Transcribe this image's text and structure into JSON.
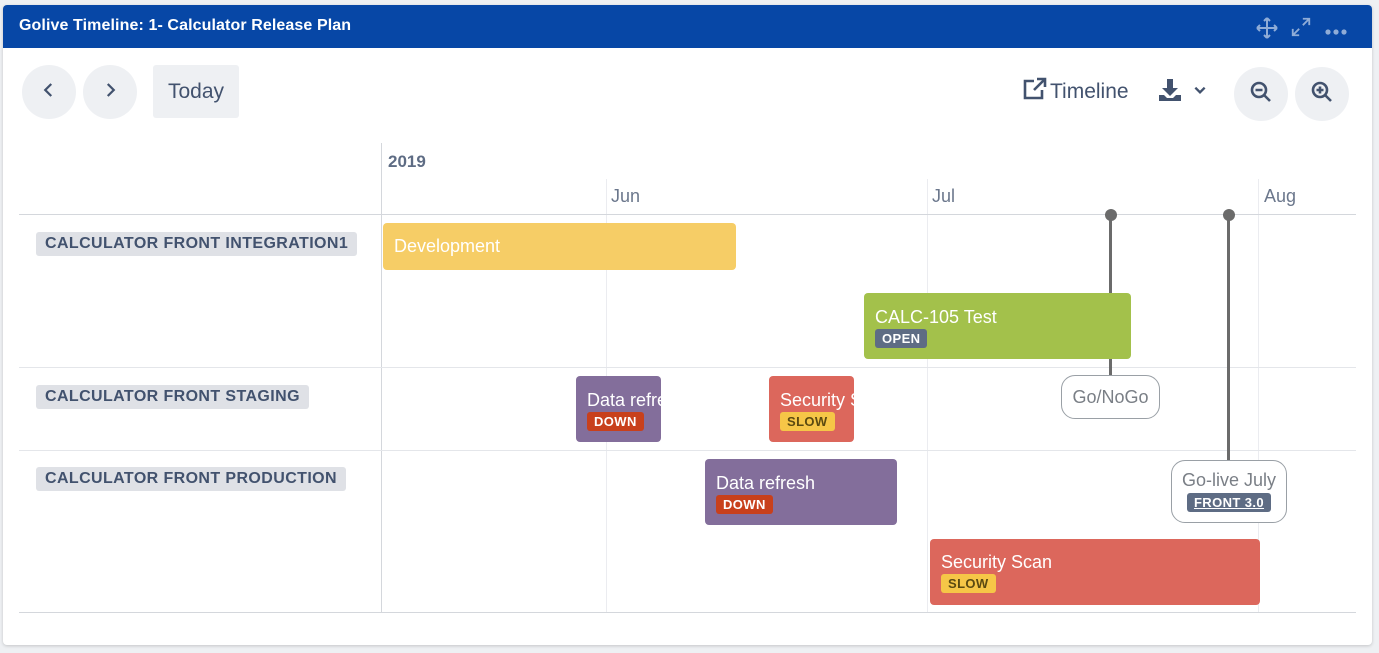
{
  "header": {
    "title": "Golive Timeline: 1- Calculator Release Plan"
  },
  "titlebar_icons": [
    "move-icon",
    "expand-icon",
    "more-icon"
  ],
  "toolbar": {
    "today_label": "Today",
    "timeline_label": "Timeline"
  },
  "timeline": {
    "year": "2019",
    "months": [
      "Jun",
      "Jul",
      "Aug"
    ]
  },
  "lanes": [
    {
      "label": "CALCULATOR FRONT INTEGRATION1"
    },
    {
      "label": "CALCULATOR FRONT STAGING"
    },
    {
      "label": "CALCULATOR FRONT PRODUCTION"
    }
  ],
  "bars": [
    {
      "text": "Development",
      "status": "",
      "color": "#f6cd66"
    },
    {
      "text": "CALC-105 Test",
      "status": "OPEN",
      "color": "#a3c14b"
    },
    {
      "text": "Data refresh",
      "status": "DOWN",
      "color": "#836e9b"
    },
    {
      "text": "Security Scan",
      "status": "SLOW",
      "color": "#dc675c"
    },
    {
      "text": "Data refresh",
      "status": "DOWN",
      "color": "#836e9b"
    },
    {
      "text": "Security Scan",
      "status": "SLOW",
      "color": "#dc675c"
    }
  ],
  "milestones": [
    {
      "label": "Go/NoGo",
      "tag": ""
    },
    {
      "label": "Go-live July",
      "tag": "FRONT 3.0"
    }
  ]
}
